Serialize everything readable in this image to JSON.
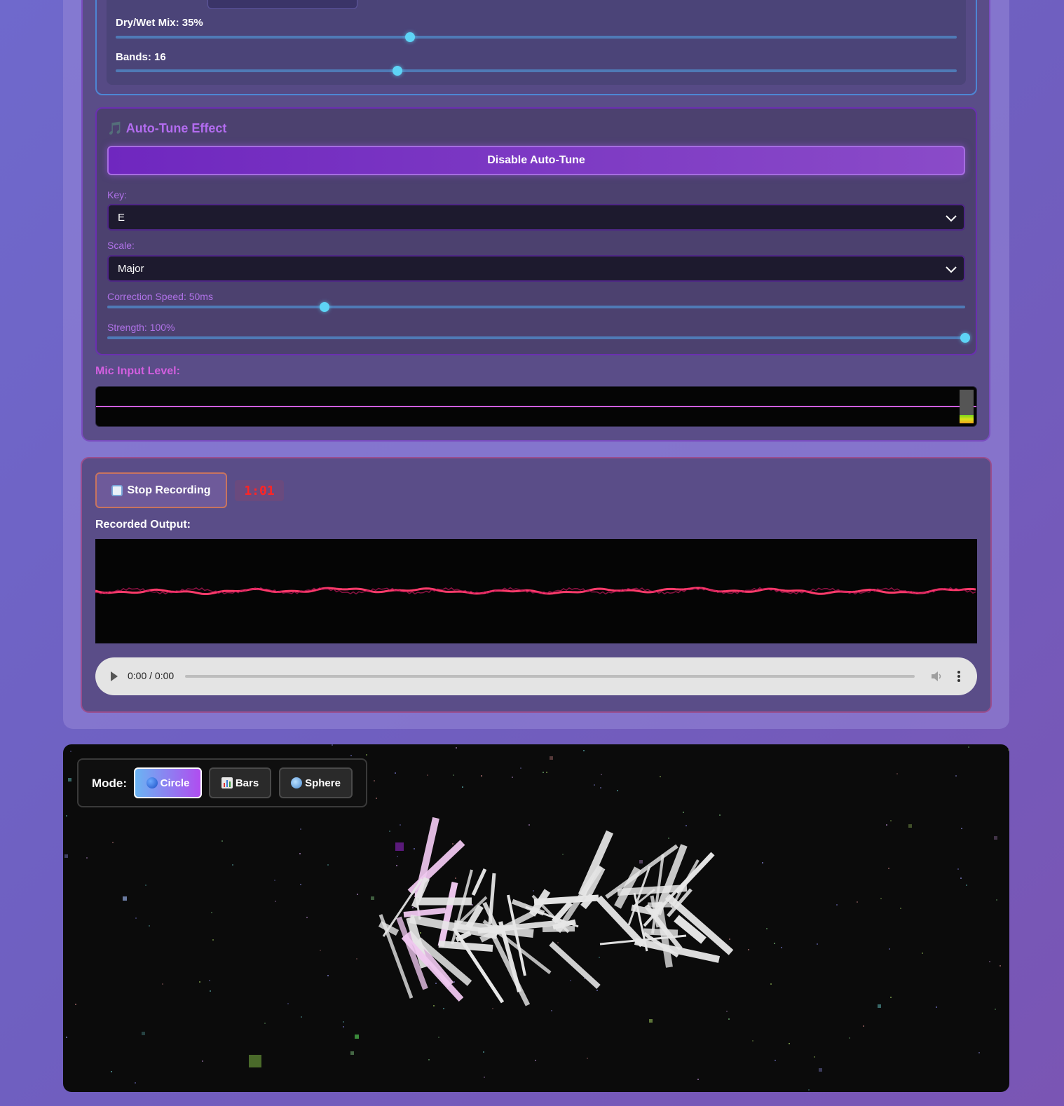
{
  "vocoder": {
    "drywet_label": "Dry/Wet Mix: 35%",
    "drywet_value": 0.35,
    "bands_label": "Bands: 16",
    "bands_value": 0.335
  },
  "autotune": {
    "title": "🎵 Auto-Tune Effect",
    "toggle_label": "Disable Auto-Tune",
    "key_label": "Key:",
    "key_value": "E",
    "scale_label": "Scale:",
    "scale_value": "Major",
    "speed_label": "Correction Speed: 50ms",
    "speed_value": 0.253,
    "strength_label": "Strength: 100%",
    "strength_value": 1.0
  },
  "mic": {
    "label": "Mic Input Level:",
    "level": 0.25
  },
  "recording": {
    "stop_label": "Stop Recording",
    "timer": "1:01",
    "output_label": "Recorded Output:",
    "player_time": "0:00 / 0:00"
  },
  "visualizer": {
    "mode_label": "Mode:",
    "modes": [
      {
        "label": "Circle",
        "icon": "blue-circle-icon",
        "active": true
      },
      {
        "label": "Bars",
        "icon": "bar-chart-icon",
        "active": false
      },
      {
        "label": "Sphere",
        "icon": "globe-icon",
        "active": false
      }
    ]
  },
  "colors": {
    "accent_cyan": "#5ed4f6",
    "autotune_purple": "#b36cf0",
    "mic_pink": "#d35fe0",
    "timer_red": "#ff2525",
    "waveform_red": "#ff3b6b"
  }
}
